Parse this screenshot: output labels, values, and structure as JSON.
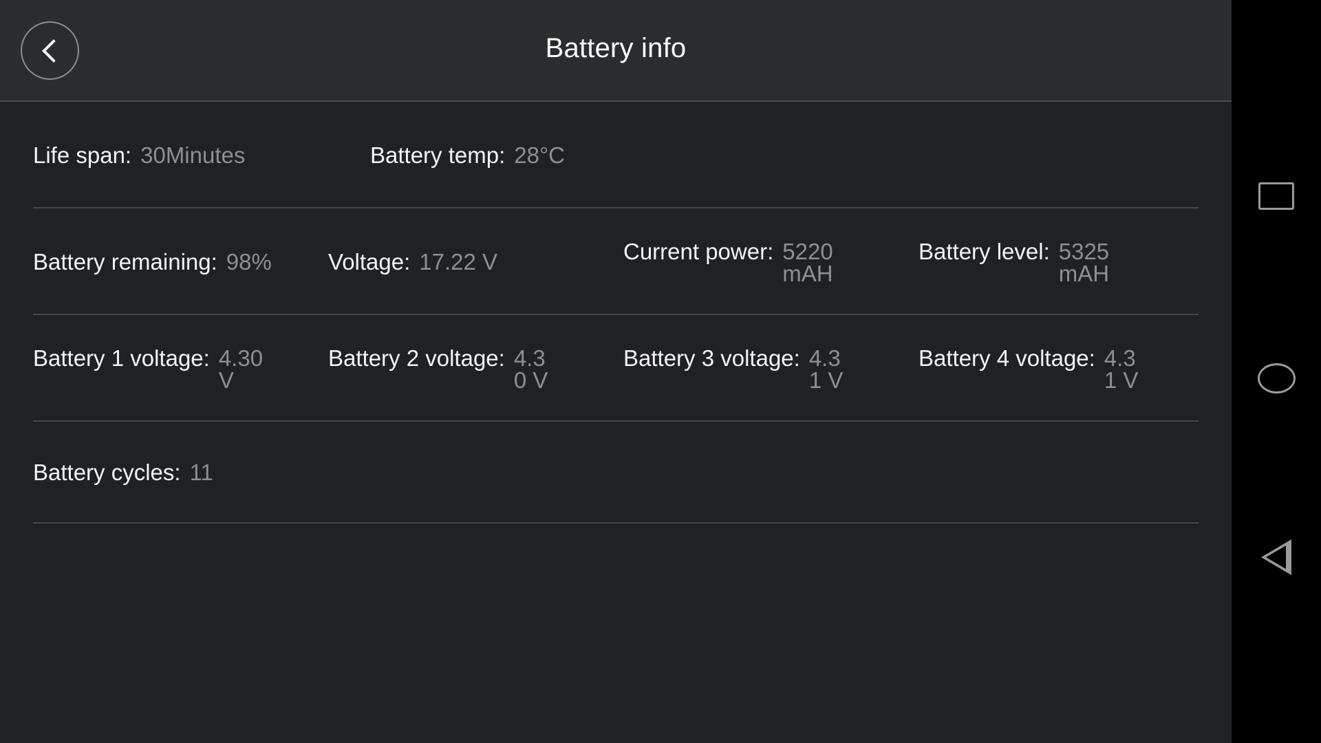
{
  "header": {
    "title": "Battery info",
    "back_icon": "chevron-left-icon"
  },
  "rows": [
    {
      "cells": [
        {
          "label": "Life span:",
          "value": "30Minutes"
        },
        {
          "label": "Battery temp:",
          "value": "28°C"
        }
      ]
    },
    {
      "cells": [
        {
          "label": "Battery remaining:",
          "value": "98%"
        },
        {
          "label": "Voltage:",
          "value": "17.22 V"
        },
        {
          "label": "Current power:",
          "value": "5220 mAH"
        },
        {
          "label": "Battery level:",
          "value": "5325 mAH"
        }
      ]
    },
    {
      "cells": [
        {
          "label": "Battery 1 voltage:",
          "value": "4.30 V"
        },
        {
          "label": "Battery 2 voltage:",
          "value": "4.30 V"
        },
        {
          "label": "Battery 3 voltage:",
          "value": "4.31 V"
        },
        {
          "label": "Battery 4 voltage:",
          "value": "4.31 V"
        }
      ]
    },
    {
      "cells": [
        {
          "label": "Battery cycles:",
          "value": "11"
        }
      ]
    }
  ],
  "navbar": {
    "recents_icon": "square-recents-icon",
    "home_icon": "circle-home-icon",
    "back_icon": "triangle-back-icon"
  },
  "colors": {
    "app_background": "#202124",
    "header_background": "#2b2c2d",
    "divider": "#46474a",
    "label_text": "#f4f4f4",
    "value_text": "#8e8f91",
    "navbar_background": "#000000",
    "nav_icon": "#9a9a9a"
  }
}
